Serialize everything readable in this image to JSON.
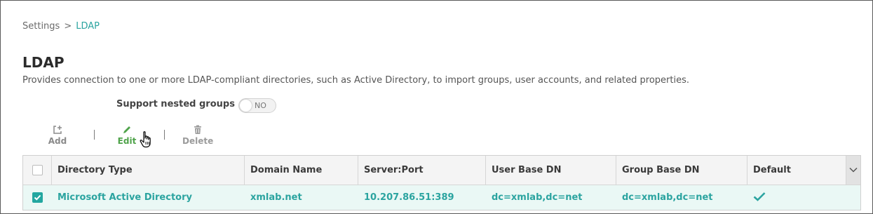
{
  "breadcrumb": {
    "root": "Settings",
    "separator": ">",
    "current": "LDAP"
  },
  "page": {
    "title": "LDAP",
    "description": "Provides connection to one or more LDAP-compliant directories, such as Active Directory, to import groups, user accounts, and related properties."
  },
  "nested_groups": {
    "label": "Support nested groups",
    "toggle_value": "NO",
    "enabled": false
  },
  "toolbar": {
    "add": {
      "label": "Add",
      "icon": "add-icon"
    },
    "edit": {
      "label": "Edit",
      "icon": "pencil-icon"
    },
    "delete": {
      "label": "Delete",
      "icon": "trash-icon"
    }
  },
  "table": {
    "headers": [
      "Directory Type",
      "Domain Name",
      "Server:Port",
      "User Base DN",
      "Group Base DN",
      "Default"
    ],
    "rows": [
      {
        "selected": true,
        "directory_type": "Microsoft Active Directory",
        "domain_name": "xmlab.net",
        "server_port": "10.207.86.51:389",
        "user_base_dn": "dc=xmlab,dc=net",
        "group_base_dn": "dc=xmlab,dc=net",
        "default": true
      }
    ]
  },
  "colors": {
    "accent": "#2ba4a0",
    "edit_green": "#4fa34a",
    "selected_row_bg": "#eaf8f5"
  }
}
